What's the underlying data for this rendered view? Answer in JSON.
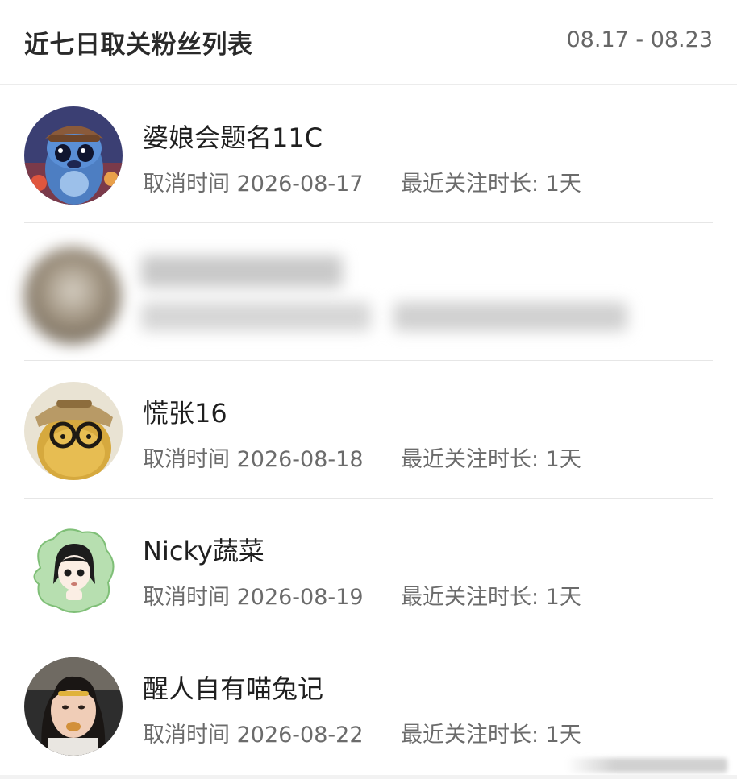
{
  "header": {
    "title": "近七日取关粉丝列表",
    "date_range": "08.17 - 08.23"
  },
  "rows": [
    {
      "name": "婆娘会题名11C",
      "cancel_label": "取消时间 2026-08-17",
      "duration_label": "最近关注时长: 1天",
      "avatar_icon": "stitch-avatar-icon"
    },
    {
      "blurred": true,
      "avatar_icon": "blurred-avatar-icon"
    },
    {
      "name": "慌张16",
      "cancel_label": "取消时间 2026-08-18",
      "duration_label": "最近关注时长: 1天",
      "avatar_icon": "plush-glasses-avatar-icon"
    },
    {
      "name": "Nicky蔬菜",
      "cancel_label": "取消时间 2026-08-19",
      "duration_label": "最近关注时长: 1天",
      "avatar_icon": "cartoon-girl-avatar-icon"
    },
    {
      "name": "醒人自有喵兔记",
      "cancel_label": "取消时间 2026-08-22",
      "duration_label": "最近关注时长: 1天",
      "avatar_icon": "photo-girl-avatar-icon"
    }
  ],
  "colors": {
    "title": "#2a2a2a",
    "secondary_text": "#6b6b6b",
    "divider": "#e6e6e6",
    "background": "#ffffff"
  }
}
